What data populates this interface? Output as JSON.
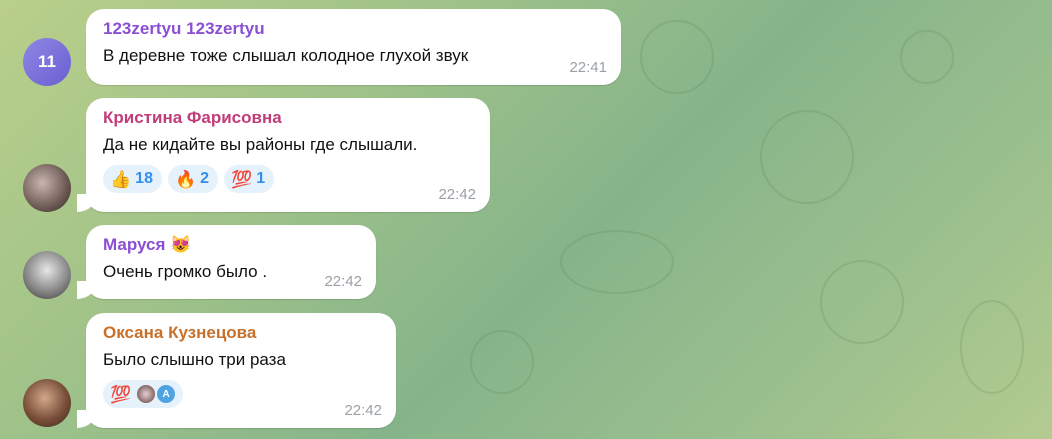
{
  "messages": [
    {
      "avatar_text": "11",
      "avatar_color": "#7b6fdc",
      "author": "123zertyu 123zertyu",
      "author_color": "#8b4fd3",
      "text": "В деревне тоже слышал   колодное глухой звук",
      "time": "22:41"
    },
    {
      "author": "Кристина Фарисовна",
      "author_color": "#c03d79",
      "text": "Да не кидайте вы районы где слышали.",
      "time": "22:42",
      "reactions": [
        {
          "emoji": "👍",
          "count": "18"
        },
        {
          "emoji": "🔥",
          "count": "2"
        },
        {
          "emoji": "💯",
          "count": "1"
        }
      ]
    },
    {
      "author": "Маруся",
      "author_emoji": "😻",
      "author_color": "#8b4fd3",
      "text": "Очень громко было .",
      "time": "22:42"
    },
    {
      "author": "Оксана Кузнецова",
      "author_color": "#c8702a",
      "text": "Было слышно три раза",
      "time": "22:42",
      "reaction_emoji": "💯",
      "reactor_initial": "A"
    }
  ]
}
